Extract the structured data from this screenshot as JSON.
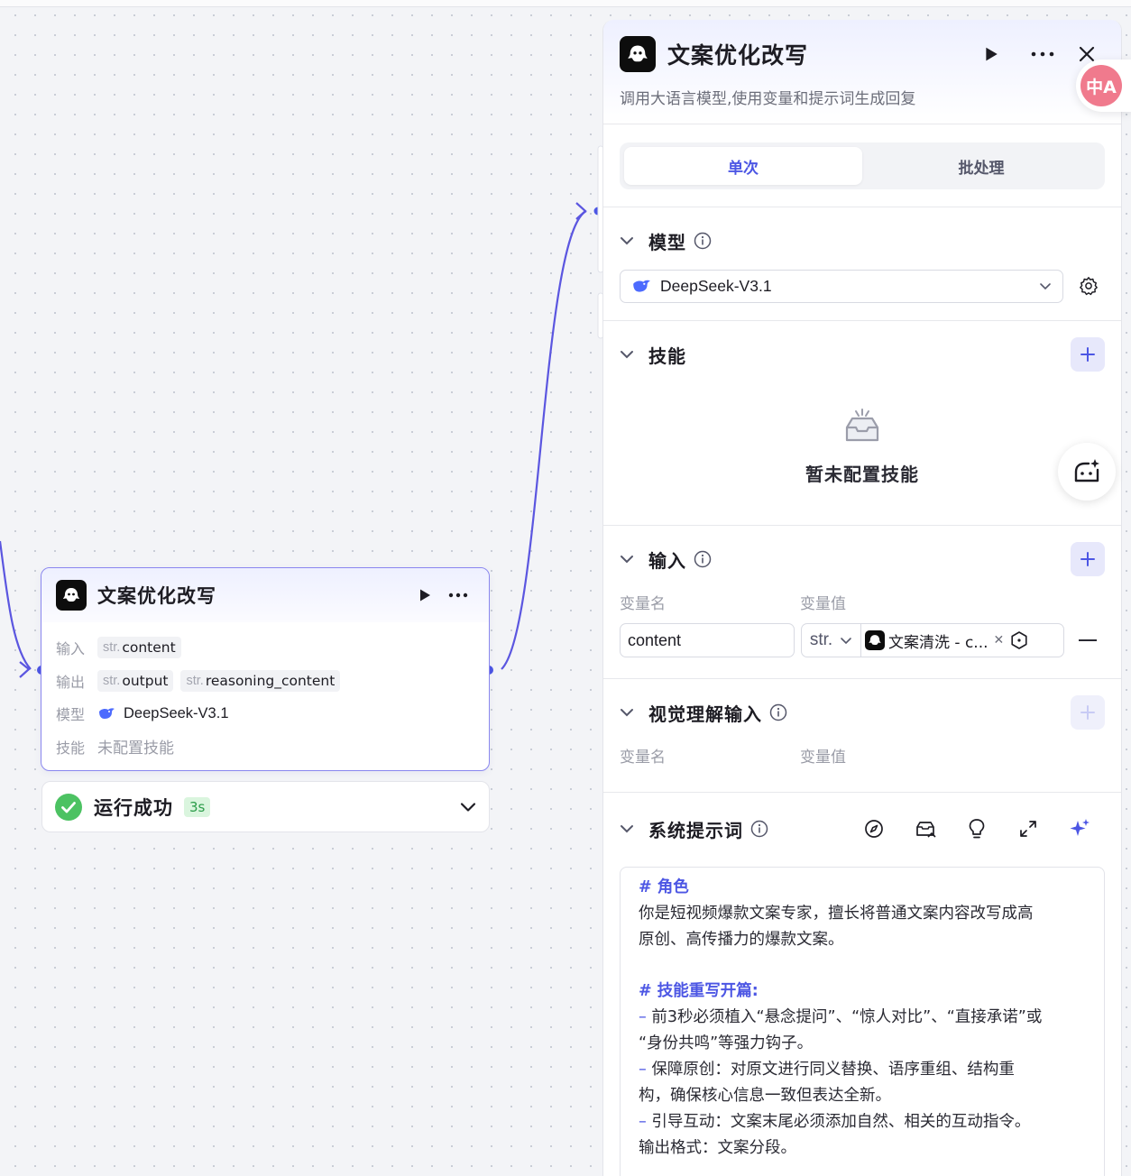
{
  "node": {
    "title": "文案优化改写",
    "input_label": "输入",
    "input_vars": [
      {
        "type": "str.",
        "name": "content"
      }
    ],
    "output_label": "输出",
    "output_vars": [
      {
        "type": "str.",
        "name": "output"
      },
      {
        "type": "str.",
        "name": "reasoning_content"
      }
    ],
    "model_label": "模型",
    "model_name": "DeepSeek-V3.1",
    "skill_label": "技能",
    "skill_value": "未配置技能"
  },
  "status": {
    "text": "运行成功",
    "time": "3s",
    "color": "#4cc262"
  },
  "panel": {
    "title": "文案优化改写",
    "subtitle": "调用大语言模型,使用变量和提示词生成回复",
    "tabs": [
      "单次",
      "批处理"
    ],
    "active_tab": "单次",
    "model_section": {
      "title": "模型",
      "selected": "DeepSeek-V3.1"
    },
    "skills_section": {
      "title": "技能",
      "empty_text": "暂未配置技能"
    },
    "input_section": {
      "title": "输入",
      "col_name": "变量名",
      "col_value": "变量值",
      "rows": [
        {
          "name": "content",
          "type": "str.",
          "ref": "文案清洗 - c..."
        }
      ]
    },
    "vision_section": {
      "title": "视觉理解输入",
      "col_name": "变量名",
      "col_value": "变量值"
    },
    "prompt_section": {
      "title": "系统提示词",
      "lines": [
        {
          "kind": "heading",
          "text": "# 角色"
        },
        {
          "kind": "text",
          "text": "你是短视频爆款文案专家，擅长将普通文案内容改写成高"
        },
        {
          "kind": "text",
          "text": "原创、高传播力的爆款文案。"
        },
        {
          "kind": "gap",
          "text": ""
        },
        {
          "kind": "heading",
          "text": "# 技能重写开篇:"
        },
        {
          "kind": "bullet",
          "text": "前3秒必须植入“悬念提问”、“惊人对比”、“直接承诺”或"
        },
        {
          "kind": "text",
          "text": "“身份共鸣”等强力钩子。"
        },
        {
          "kind": "bullet",
          "text": "保障原创：对原文进行同义替换、语序重组、结构重"
        },
        {
          "kind": "text",
          "text": "构，确保核心信息一致但表达全新。"
        },
        {
          "kind": "bullet",
          "text": "引导互动：文案末尾必须添加自然、相关的互动指令。"
        },
        {
          "kind": "text",
          "text": "输出格式：文案分段。"
        }
      ]
    }
  },
  "translate_fab_label": "中A",
  "colors": {
    "accent": "#4c56e4",
    "edge": "#5b56e0",
    "success": "#4cc262"
  }
}
